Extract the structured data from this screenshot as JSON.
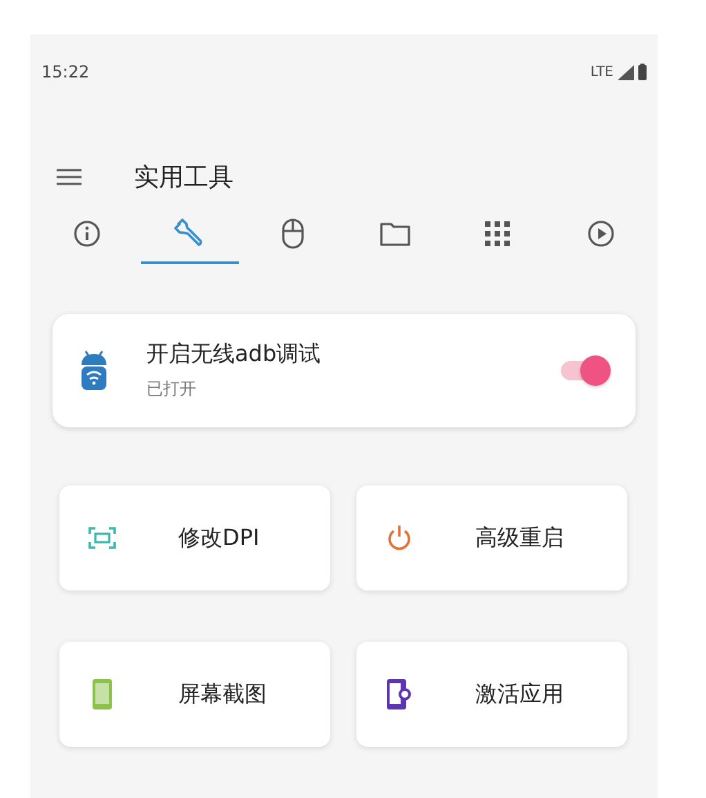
{
  "status_bar": {
    "time": "15:22",
    "network": "LTE"
  },
  "app_bar": {
    "title": "实用工具"
  },
  "tabs": [
    {
      "kind": "info",
      "selected": false
    },
    {
      "kind": "wrench",
      "selected": true
    },
    {
      "kind": "mouse",
      "selected": false
    },
    {
      "kind": "folder",
      "selected": false
    },
    {
      "kind": "grid",
      "selected": false
    },
    {
      "kind": "play",
      "selected": false
    }
  ],
  "wireless_adb": {
    "title": "开启无线adb调试",
    "subtitle": "已打开",
    "on": true
  },
  "tools": [
    {
      "label": "修改DPI",
      "kind": "dpi",
      "color": "#3bb8b0"
    },
    {
      "label": "高级重启",
      "kind": "power",
      "color": "#e0733a"
    },
    {
      "label": "屏幕截图",
      "kind": "screenshot",
      "color": "#8bc34a"
    },
    {
      "label": "激活应用",
      "kind": "activate",
      "color": "#5e35b1"
    }
  ]
}
